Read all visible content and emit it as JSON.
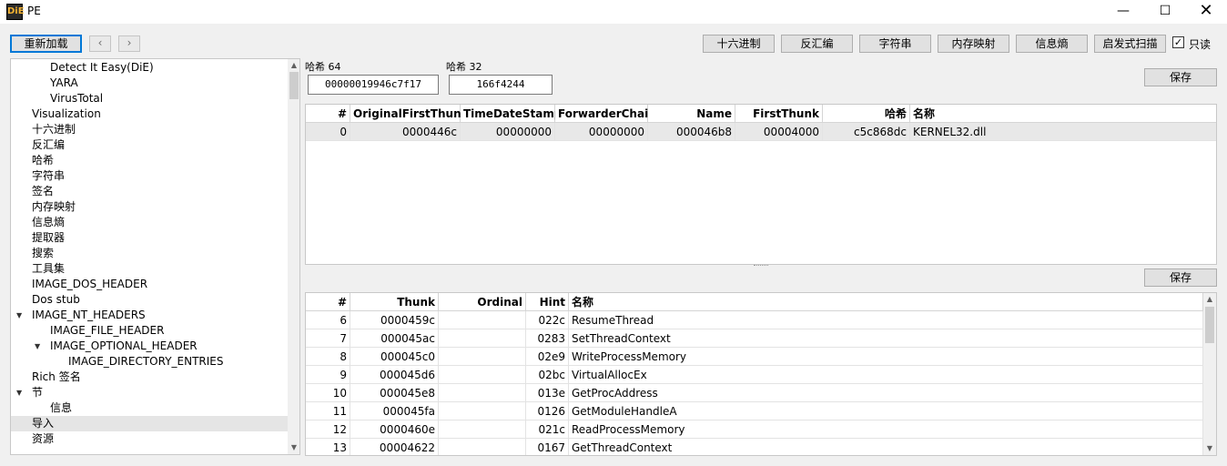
{
  "window": {
    "title": "PE",
    "icon_text": "DiE",
    "minimize_icon": "minimize-icon",
    "maximize_icon": "maximize-icon",
    "close_icon": "close-icon"
  },
  "toolbar": {
    "reload": "重新加载",
    "back_glyph": "‹",
    "forward_glyph": "›",
    "buttons": [
      "十六进制",
      "反汇编",
      "字符串",
      "内存映射",
      "信息熵",
      "启发式扫描"
    ],
    "readonly_label": "只读",
    "readonly_checked": "✓"
  },
  "tree": {
    "items": [
      {
        "label": "Detect It Easy(DiE)"
      },
      {
        "label": "YARA"
      },
      {
        "label": "VirusTotal"
      },
      {
        "label": "Visualization"
      },
      {
        "label": "十六进制"
      },
      {
        "label": "反汇编"
      },
      {
        "label": "哈希"
      },
      {
        "label": "字符串"
      },
      {
        "label": "签名"
      },
      {
        "label": "内存映射"
      },
      {
        "label": "信息熵"
      },
      {
        "label": "提取器"
      },
      {
        "label": "搜索"
      },
      {
        "label": "工具集"
      },
      {
        "label": "IMAGE_DOS_HEADER"
      },
      {
        "label": "Dos stub"
      },
      {
        "label": "IMAGE_NT_HEADERS"
      },
      {
        "label": "IMAGE_FILE_HEADER"
      },
      {
        "label": "IMAGE_OPTIONAL_HEADER"
      },
      {
        "label": "IMAGE_DIRECTORY_ENTRIES"
      },
      {
        "label": "Rich 签名"
      },
      {
        "label": "节"
      },
      {
        "label": "信息"
      },
      {
        "label": "导入"
      },
      {
        "label": "资源"
      }
    ],
    "expand_glyph": "▼"
  },
  "hash": {
    "label64": "哈希 64",
    "value64": "00000019946c7f17",
    "label32": "哈希 32",
    "value32": "166f4244",
    "save": "保存"
  },
  "imports_table": {
    "headers": [
      "#",
      "OriginalFirstThunk",
      "TimeDateStamp",
      "ForwarderChain",
      "Name",
      "FirstThunk",
      "哈希",
      "名称"
    ],
    "rows": [
      [
        "0",
        "0000446c",
        "00000000",
        "00000000",
        "000046b8",
        "00004000",
        "c5c868dc",
        "KERNEL32.dll"
      ]
    ]
  },
  "functions_table": {
    "save": "保存",
    "headers": [
      "#",
      "Thunk",
      "Ordinal",
      "Hint",
      "名称"
    ],
    "rows": [
      [
        "6",
        "0000459c",
        "",
        "022c",
        "ResumeThread"
      ],
      [
        "7",
        "000045ac",
        "",
        "0283",
        "SetThreadContext"
      ],
      [
        "8",
        "000045c0",
        "",
        "02e9",
        "WriteProcessMemory"
      ],
      [
        "9",
        "000045d6",
        "",
        "02bc",
        "VirtualAllocEx"
      ],
      [
        "10",
        "000045e8",
        "",
        "013e",
        "GetProcAddress"
      ],
      [
        "11",
        "000045fa",
        "",
        "0126",
        "GetModuleHandleA"
      ],
      [
        "12",
        "0000460e",
        "",
        "021c",
        "ReadProcessMemory"
      ],
      [
        "13",
        "00004622",
        "",
        "0167",
        "GetThreadContext"
      ]
    ]
  },
  "scroll": {
    "up_glyph": "▲",
    "down_glyph": "▼"
  }
}
